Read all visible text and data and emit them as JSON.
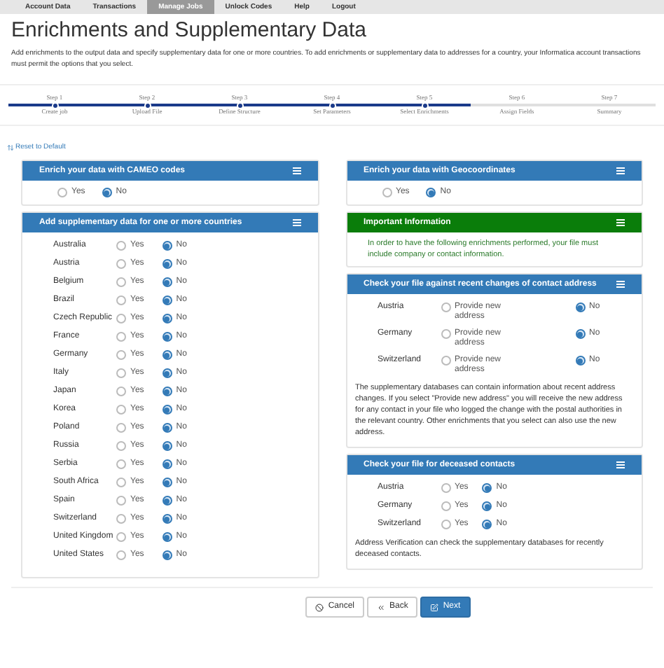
{
  "nav": [
    {
      "label": "Account Data",
      "selected": false
    },
    {
      "label": "Transactions",
      "selected": false
    },
    {
      "label": "Manage Jobs",
      "selected": true
    },
    {
      "label": "Unlock Codes",
      "selected": false
    },
    {
      "label": "Help",
      "selected": false
    },
    {
      "label": "Logout",
      "selected": false
    }
  ],
  "title": "Enrichments and Supplementary Data",
  "description": "Add enrichments to the output data and specify supplementary data for one or more countries. To add enrichments or supplementary data to addresses for a country, your Informatica account transactions must permit the options that you select.",
  "steps": [
    {
      "step": "Step 1",
      "label": "Create job",
      "done": true
    },
    {
      "step": "Step 2",
      "label": "Upload File",
      "done": true
    },
    {
      "step": "Step 3",
      "label": "Define Structure",
      "done": true
    },
    {
      "step": "Step 4",
      "label": "Set Parameters",
      "done": true
    },
    {
      "step": "Step 5",
      "label": "Select Enrichments",
      "done": true
    },
    {
      "step": "Step 6",
      "label": "Assign Fields",
      "done": false
    },
    {
      "step": "Step 7",
      "label": "Summary",
      "done": false
    }
  ],
  "reset_link": "Reset to Default",
  "cameo": {
    "title": "Enrich your data with CAMEO codes",
    "options": [
      {
        "label": "Yes",
        "selected": false
      },
      {
        "label": "No",
        "selected": true
      }
    ]
  },
  "supplementary": {
    "title": "Add supplementary data for one or more countries",
    "rows": [
      {
        "name": "Australia",
        "options": [
          {
            "label": "Yes",
            "selected": false
          },
          {
            "label": "No",
            "selected": true
          }
        ]
      },
      {
        "name": "Austria",
        "options": [
          {
            "label": "Yes",
            "selected": false
          },
          {
            "label": "No",
            "selected": true
          }
        ]
      },
      {
        "name": "Belgium",
        "options": [
          {
            "label": "Yes",
            "selected": false
          },
          {
            "label": "No",
            "selected": true
          }
        ]
      },
      {
        "name": "Brazil",
        "options": [
          {
            "label": "Yes",
            "selected": false
          },
          {
            "label": "No",
            "selected": true
          }
        ]
      },
      {
        "name": "Czech Republic",
        "options": [
          {
            "label": "Yes",
            "selected": false
          },
          {
            "label": "No",
            "selected": true
          }
        ]
      },
      {
        "name": "France",
        "options": [
          {
            "label": "Yes",
            "selected": false
          },
          {
            "label": "No",
            "selected": true
          }
        ]
      },
      {
        "name": "Germany",
        "options": [
          {
            "label": "Yes",
            "selected": false
          },
          {
            "label": "No",
            "selected": true
          }
        ]
      },
      {
        "name": "Italy",
        "options": [
          {
            "label": "Yes",
            "selected": false
          },
          {
            "label": "No",
            "selected": true
          }
        ]
      },
      {
        "name": "Japan",
        "options": [
          {
            "label": "Yes",
            "selected": false
          },
          {
            "label": "No",
            "selected": true
          }
        ]
      },
      {
        "name": "Korea",
        "options": [
          {
            "label": "Yes",
            "selected": false
          },
          {
            "label": "No",
            "selected": true
          }
        ]
      },
      {
        "name": "Poland",
        "options": [
          {
            "label": "Yes",
            "selected": false
          },
          {
            "label": "No",
            "selected": true
          }
        ]
      },
      {
        "name": "Russia",
        "options": [
          {
            "label": "Yes",
            "selected": false
          },
          {
            "label": "No",
            "selected": true
          }
        ]
      },
      {
        "name": "Serbia",
        "options": [
          {
            "label": "Yes",
            "selected": false
          },
          {
            "label": "No",
            "selected": true
          }
        ]
      },
      {
        "name": "South Africa",
        "options": [
          {
            "label": "Yes",
            "selected": false
          },
          {
            "label": "No",
            "selected": true
          }
        ]
      },
      {
        "name": "Spain",
        "options": [
          {
            "label": "Yes",
            "selected": false
          },
          {
            "label": "No",
            "selected": true
          }
        ]
      },
      {
        "name": "Switzerland",
        "options": [
          {
            "label": "Yes",
            "selected": false
          },
          {
            "label": "No",
            "selected": true
          }
        ]
      },
      {
        "name": "United Kingdom",
        "options": [
          {
            "label": "Yes",
            "selected": false
          },
          {
            "label": "No",
            "selected": true
          }
        ]
      },
      {
        "name": "United States",
        "options": [
          {
            "label": "Yes",
            "selected": false
          },
          {
            "label": "No",
            "selected": true
          }
        ]
      }
    ]
  },
  "geocoordinates": {
    "title": "Enrich your data with Geocoordinates",
    "options": [
      {
        "label": "Yes",
        "selected": false
      },
      {
        "label": "No",
        "selected": true
      }
    ]
  },
  "important": {
    "title": "Important Information",
    "text": "In order to have the following enrichments performed, your file must include company or contact information."
  },
  "address_changes": {
    "title": "Check your file against recent changes of contact address",
    "rows": [
      {
        "name": "Austria",
        "options": [
          {
            "label": "Provide new address",
            "selected": false
          },
          {
            "label": "No",
            "selected": true
          }
        ]
      },
      {
        "name": "Germany",
        "options": [
          {
            "label": "Provide new address",
            "selected": false
          },
          {
            "label": "No",
            "selected": true
          }
        ]
      },
      {
        "name": "Switzerland",
        "options": [
          {
            "label": "Provide new address",
            "selected": false
          },
          {
            "label": "No",
            "selected": true
          }
        ]
      }
    ],
    "note": "The supplementary databases can contain information about recent address changes. If you select \"Provide new address\" you will receive the new address for any contact in your file who logged the change with the postal authorities in the relevant country. Other enrichments that you select can also use the new address."
  },
  "deceased": {
    "title": "Check your file for deceased contacts",
    "rows": [
      {
        "name": "Austria",
        "options": [
          {
            "label": "Yes",
            "selected": false
          },
          {
            "label": "No",
            "selected": true
          }
        ]
      },
      {
        "name": "Germany",
        "options": [
          {
            "label": "Yes",
            "selected": false
          },
          {
            "label": "No",
            "selected": true
          }
        ]
      },
      {
        "name": "Switzerland",
        "options": [
          {
            "label": "Yes",
            "selected": false
          },
          {
            "label": "No",
            "selected": true
          }
        ]
      }
    ],
    "note": "Address Verification can check the supplementary databases for recently deceased contacts."
  },
  "buttons": [
    {
      "label": "Cancel",
      "kind": "cancel"
    },
    {
      "label": "Back",
      "kind": "back"
    },
    {
      "label": "Next",
      "kind": "next"
    }
  ]
}
